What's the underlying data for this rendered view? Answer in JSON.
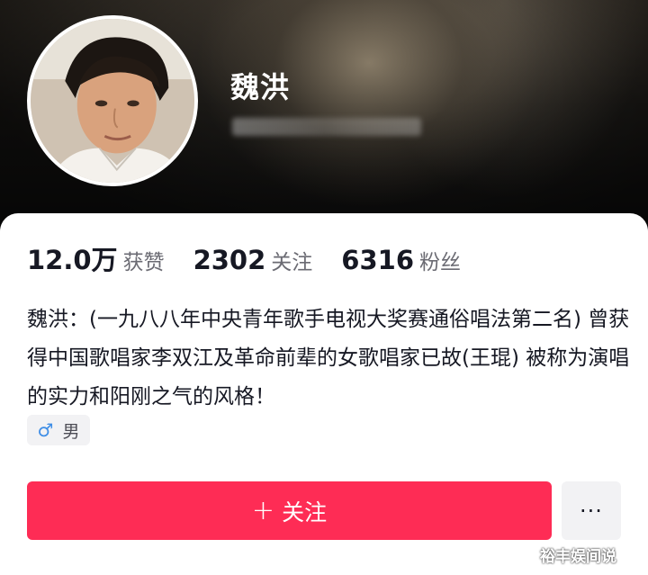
{
  "profile": {
    "name": "魏洪",
    "bio": "魏洪：(一九八八年中央青年歌手电视大奖赛通俗唱法第二名) 曾获得中国歌唱家李双江及革命前辈的女歌唱家已故(王琨) 被称为演唱的实力和阳刚之气的风格！",
    "gender_icon": "♂",
    "gender_label": "男"
  },
  "stats": [
    {
      "value": "12.0万",
      "label": "获赞"
    },
    {
      "value": "2302",
      "label": "关注"
    },
    {
      "value": "6316",
      "label": "粉丝"
    }
  ],
  "actions": {
    "follow_icon": "+",
    "follow_label": "关注",
    "more_label": "···"
  },
  "watermark": "裕丰娱间说",
  "colors": {
    "accent": "#fe2c55",
    "gender_icon": "#3d8de6",
    "text_primary": "#161823",
    "text_secondary": "#6b6b73"
  }
}
